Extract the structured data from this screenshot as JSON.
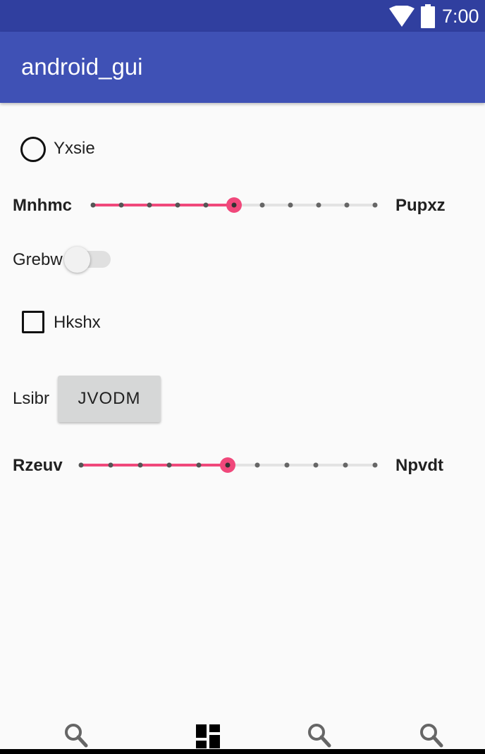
{
  "status_bar": {
    "time": "7:00",
    "wifi_icon": "wifi-icon",
    "battery_icon": "battery-icon",
    "color": "#303f9f"
  },
  "app_bar": {
    "title": "android_gui",
    "color": "#3f51b5"
  },
  "radio": {
    "label": "Yxsie",
    "checked": false
  },
  "slider1": {
    "left_label": "Mnhmc",
    "right_label": "Pupxz",
    "steps": 10,
    "value": 5
  },
  "switch": {
    "label": "Grebw",
    "on": false
  },
  "checkbox": {
    "label": "Hkshx",
    "checked": false
  },
  "button_row": {
    "label": "Lsibr",
    "button_label": "JVODM"
  },
  "slider2": {
    "left_label": "Rzeuv",
    "right_label": "Npvdt",
    "steps": 10,
    "value": 5
  },
  "accent_color": "#f0487b",
  "bottom_nav": {
    "icons": [
      "search-icon",
      "dashboard-icon",
      "search-icon",
      "search-icon"
    ]
  }
}
